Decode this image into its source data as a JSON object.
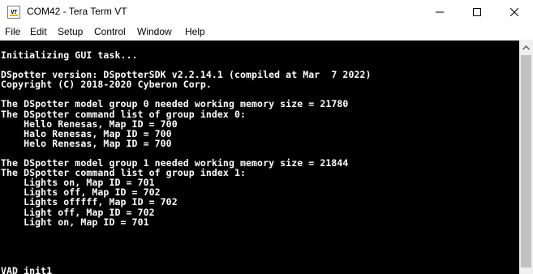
{
  "window": {
    "title": "COM42 - Tera Term VT",
    "icon_label": "VT",
    "icon": "teraterm-icon",
    "buttons": [
      "minimize-icon",
      "maximize-icon",
      "close-icon"
    ]
  },
  "menu": [
    "File",
    "Edit",
    "Setup",
    "Control",
    "Window",
    "Help"
  ],
  "terminal": {
    "background": "#000000",
    "foreground": "#ffffff",
    "lines": [
      "Initializing GUI task...",
      "",
      "DSpotter version: DSpotterSDK v2.2.14.1 (compiled at Mar  7 2022)",
      "Copyright (C) 2018-2020 Cyberon Corp.",
      "",
      "The DSpotter model group 0 needed working memory size = 21780",
      "The DSpotter command list of group index 0:",
      "    Hello Renesas, Map ID = 700",
      "    Halo Renesas, Map ID = 700",
      "    Helo Renesas, Map ID = 700",
      "",
      "The DSpotter model group 1 needed working memory size = 21844",
      "The DSpotter command list of group index 1:",
      "    Lights on, Map ID = 701",
      "    Lights off, Map ID = 702",
      "    Lights offfff, Map ID = 702",
      "    Light off, Map ID = 702",
      "    Light on, Map ID = 701",
      "",
      "",
      "",
      "",
      "VAD init1"
    ]
  },
  "scrollbar": {
    "up_icon": "scroll-up-arrow-icon"
  }
}
